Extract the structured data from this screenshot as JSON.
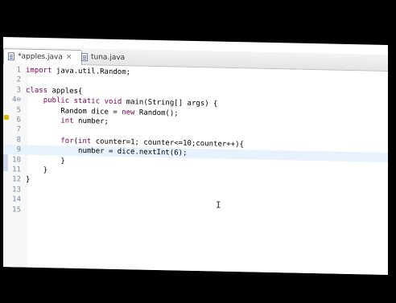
{
  "tabs": [
    {
      "label": "*apples.java",
      "close": "✕"
    },
    {
      "label": "tuna.java"
    }
  ],
  "editor": {
    "lines": [
      {
        "n": "1",
        "parts": [
          {
            "t": "import",
            "c": "kw"
          },
          {
            "t": " java.util.Random;"
          }
        ]
      },
      {
        "n": "2",
        "parts": []
      },
      {
        "n": "3",
        "parts": [
          {
            "t": "class",
            "c": "kw"
          },
          {
            "t": " apples{"
          }
        ]
      },
      {
        "n": "4⊖",
        "parts": [
          {
            "t": "    "
          },
          {
            "t": "public",
            "c": "kw"
          },
          {
            "t": " "
          },
          {
            "t": "static",
            "c": "kw"
          },
          {
            "t": " "
          },
          {
            "t": "void",
            "c": "kw"
          },
          {
            "t": " main(String[] args) {"
          }
        ]
      },
      {
        "n": "5",
        "parts": [
          {
            "t": "        Random dice = "
          },
          {
            "t": "new",
            "c": "kw"
          },
          {
            "t": " Random();"
          }
        ]
      },
      {
        "n": "6",
        "parts": [
          {
            "t": "        "
          },
          {
            "t": "int",
            "c": "kw"
          },
          {
            "t": " number;"
          }
        ]
      },
      {
        "n": "7",
        "parts": []
      },
      {
        "n": "8",
        "parts": [
          {
            "t": "        "
          },
          {
            "t": "for",
            "c": "kw"
          },
          {
            "t": "("
          },
          {
            "t": "int",
            "c": "kw"
          },
          {
            "t": " counter=1; counter<=10;counter++){"
          }
        ]
      },
      {
        "n": "9",
        "parts": [
          {
            "t": "            number = dice.nextInt(6);"
          }
        ],
        "current": true
      },
      {
        "n": "10",
        "parts": [
          {
            "t": "        }"
          }
        ]
      },
      {
        "n": "11",
        "parts": [
          {
            "t": "    }"
          }
        ]
      },
      {
        "n": "12",
        "parts": [
          {
            "t": "}"
          }
        ]
      },
      {
        "n": "13",
        "parts": []
      },
      {
        "n": "14",
        "parts": []
      },
      {
        "n": "15",
        "parts": []
      }
    ]
  },
  "colors": {
    "keyword": "#7f0055",
    "current_line": "#e8f2fe",
    "line_number": "#7a8aa0"
  }
}
